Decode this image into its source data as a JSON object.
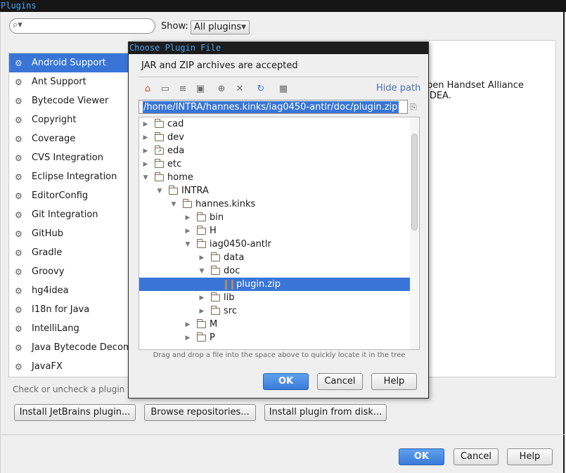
{
  "window": {
    "title": "Plugins"
  },
  "toolbar": {
    "search_placeholder": "",
    "search_icon": "search-icon",
    "show_label": "Show:",
    "show_value": "All plugins"
  },
  "plugins": [
    {
      "label": "Android Support",
      "selected": true
    },
    {
      "label": "Ant Support"
    },
    {
      "label": "Bytecode Viewer"
    },
    {
      "label": "Copyright"
    },
    {
      "label": "Coverage"
    },
    {
      "label": "CVS Integration"
    },
    {
      "label": "Eclipse Integration"
    },
    {
      "label": "EditorConfig"
    },
    {
      "label": "Git Integration"
    },
    {
      "label": "GitHub"
    },
    {
      "label": "Gradle"
    },
    {
      "label": "Groovy"
    },
    {
      "label": "hg4idea"
    },
    {
      "label": "I18n for Java"
    },
    {
      "label": "IntelliLang"
    },
    {
      "label": "Java Bytecode Decom"
    },
    {
      "label": "JavaFX"
    }
  ],
  "details": {
    "line1": "pen Handset Alliance",
    "line2": "IDEA."
  },
  "hint": "Check or uncheck a plugin to",
  "actions": {
    "install_jetbrains": "Install JetBrains plugin...",
    "browse": "Browse repositories...",
    "install_disk": "Install plugin from disk..."
  },
  "footer": {
    "ok": "OK",
    "cancel": "Cancel",
    "help": "Help"
  },
  "dialog": {
    "title": "Choose Plugin File",
    "description": "JAR and ZIP archives are accepted",
    "hide_path": "Hide path",
    "path": "/home/INTRA/hannes.kinks/iag0450-antlr/doc/plugin.zip",
    "toolbar_icons": [
      "home-icon",
      "desktop-icon",
      "module-icon",
      "project-icon",
      "new-folder-icon",
      "delete-icon",
      "refresh-icon",
      "show-hidden-icon"
    ],
    "tree": [
      {
        "label": "cad",
        "depth": 0,
        "expand": "collapsed",
        "type": "folder"
      },
      {
        "label": "dev",
        "depth": 0,
        "expand": "collapsed",
        "type": "folder"
      },
      {
        "label": "eda",
        "depth": 0,
        "expand": "collapsed",
        "type": "folder-link"
      },
      {
        "label": "etc",
        "depth": 0,
        "expand": "collapsed",
        "type": "folder"
      },
      {
        "label": "home",
        "depth": 0,
        "expand": "expanded",
        "type": "folder"
      },
      {
        "label": "INTRA",
        "depth": 1,
        "expand": "expanded",
        "type": "folder"
      },
      {
        "label": "hannes.kinks",
        "depth": 2,
        "expand": "expanded",
        "type": "folder"
      },
      {
        "label": "bin",
        "depth": 3,
        "expand": "collapsed",
        "type": "folder"
      },
      {
        "label": "H",
        "depth": 3,
        "expand": "collapsed",
        "type": "folder"
      },
      {
        "label": "iag0450-antlr",
        "depth": 3,
        "expand": "expanded",
        "type": "folder"
      },
      {
        "label": "data",
        "depth": 4,
        "expand": "collapsed",
        "type": "folder"
      },
      {
        "label": "doc",
        "depth": 4,
        "expand": "expanded",
        "type": "folder"
      },
      {
        "label": "plugin.zip",
        "depth": 5,
        "expand": "none",
        "type": "zip",
        "selected": true
      },
      {
        "label": "lib",
        "depth": 4,
        "expand": "collapsed",
        "type": "folder"
      },
      {
        "label": "src",
        "depth": 4,
        "expand": "collapsed",
        "type": "folder"
      },
      {
        "label": "M",
        "depth": 3,
        "expand": "collapsed",
        "type": "folder"
      },
      {
        "label": "P",
        "depth": 3,
        "expand": "collapsed",
        "type": "folder"
      }
    ],
    "drag_hint": "Drag and drop a file into the space above to quickly locate it in the tree",
    "ok": "OK",
    "cancel": "Cancel",
    "help": "Help"
  },
  "colors": {
    "accent": "#3875d7",
    "title_text": "#4aa3f2",
    "primary_button": "#3a7bd9"
  }
}
